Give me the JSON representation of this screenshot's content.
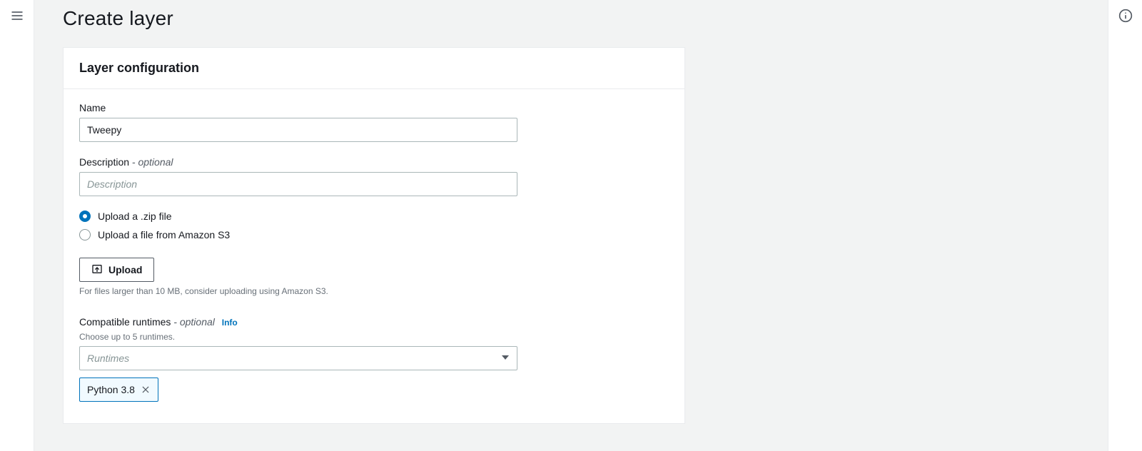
{
  "page": {
    "title": "Create layer"
  },
  "panel": {
    "title": "Layer configuration"
  },
  "nameField": {
    "label": "Name",
    "value": "Tweepy"
  },
  "descField": {
    "label": "Description",
    "optional": "- optional",
    "placeholder": "Description",
    "value": ""
  },
  "uploadRadio": {
    "zip": "Upload a .zip file",
    "s3": "Upload a file from Amazon S3",
    "selected": "zip"
  },
  "uploadBtn": {
    "label": "Upload",
    "hint": "For files larger than 10 MB, consider uploading using Amazon S3."
  },
  "runtimes": {
    "label": "Compatible runtimes",
    "optional": "- optional",
    "info": "Info",
    "hint": "Choose up to 5 runtimes.",
    "placeholder": "Runtimes",
    "selected": [
      "Python 3.8"
    ]
  }
}
